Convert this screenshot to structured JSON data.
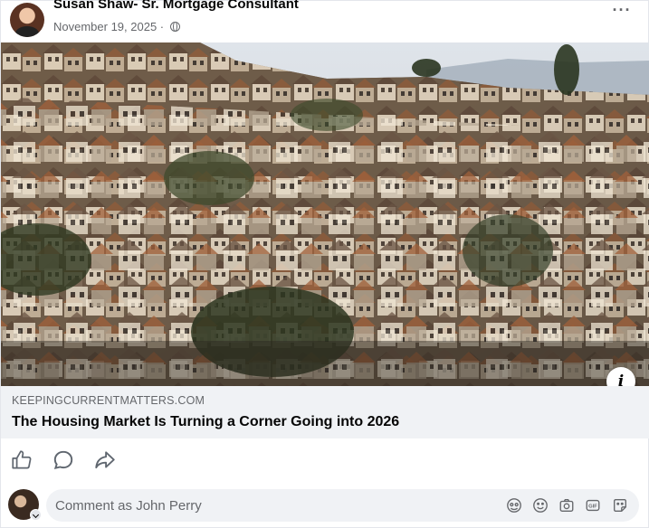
{
  "post": {
    "author": "Susan Shaw- Sr. Mortgage Consultant",
    "date": "November 19, 2025",
    "separator": " · ",
    "audience_icon": "globe-icon",
    "more_icon": "more-horizontal-icon",
    "more_label": "···"
  },
  "photo": {
    "subject": "hillside-houses-photo",
    "info_label": "i"
  },
  "link_preview": {
    "domain": "KEEPINGCURRENTMATTERS.COM",
    "title": "The Housing Market Is Turning a Corner Going into 2026"
  },
  "actions": [
    {
      "icon": "like-icon"
    },
    {
      "icon": "comment-icon"
    },
    {
      "icon": "share-icon"
    }
  ],
  "comment": {
    "placeholder": "Comment as John Perry",
    "tools": [
      "avatar-sticker-icon",
      "emoji-icon",
      "camera-icon",
      "gif-icon",
      "sticker-icon"
    ]
  },
  "colors": {
    "text_primary": "#050505",
    "text_secondary": "#65676b",
    "surface_gray": "#f0f2f5"
  }
}
